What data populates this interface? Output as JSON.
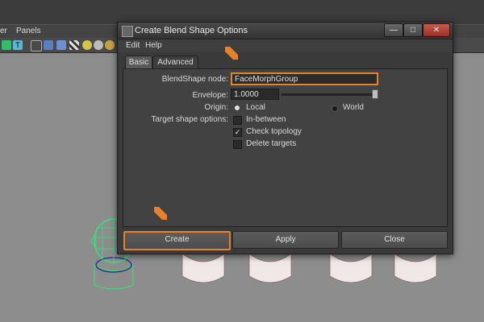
{
  "workspace": {
    "menu": [
      "er",
      "Panels"
    ]
  },
  "dialog": {
    "title": "Create Blend Shape Options",
    "menu": {
      "edit": "Edit",
      "help": "Help"
    },
    "tabs": {
      "basic": "Basic",
      "advanced": "Advanced"
    },
    "blendshape_node": {
      "label": "BlendShape node:",
      "value": "FaceMorphGroup"
    },
    "envelope": {
      "label": "Envelope:",
      "value": "1.0000",
      "slider_fraction": 1.0
    },
    "origin": {
      "label": "Origin:",
      "local": "Local",
      "world": "World",
      "selected": "local"
    },
    "target_options": {
      "label": "Target shape options:",
      "in_between": "In-between",
      "check_topology": "Check topology",
      "delete_targets": "Delete targets"
    },
    "buttons": {
      "create": "Create",
      "apply": "Apply",
      "close": "Close"
    }
  },
  "colors": {
    "highlight": "#e8822a",
    "selected_mesh": "#37e07a"
  }
}
